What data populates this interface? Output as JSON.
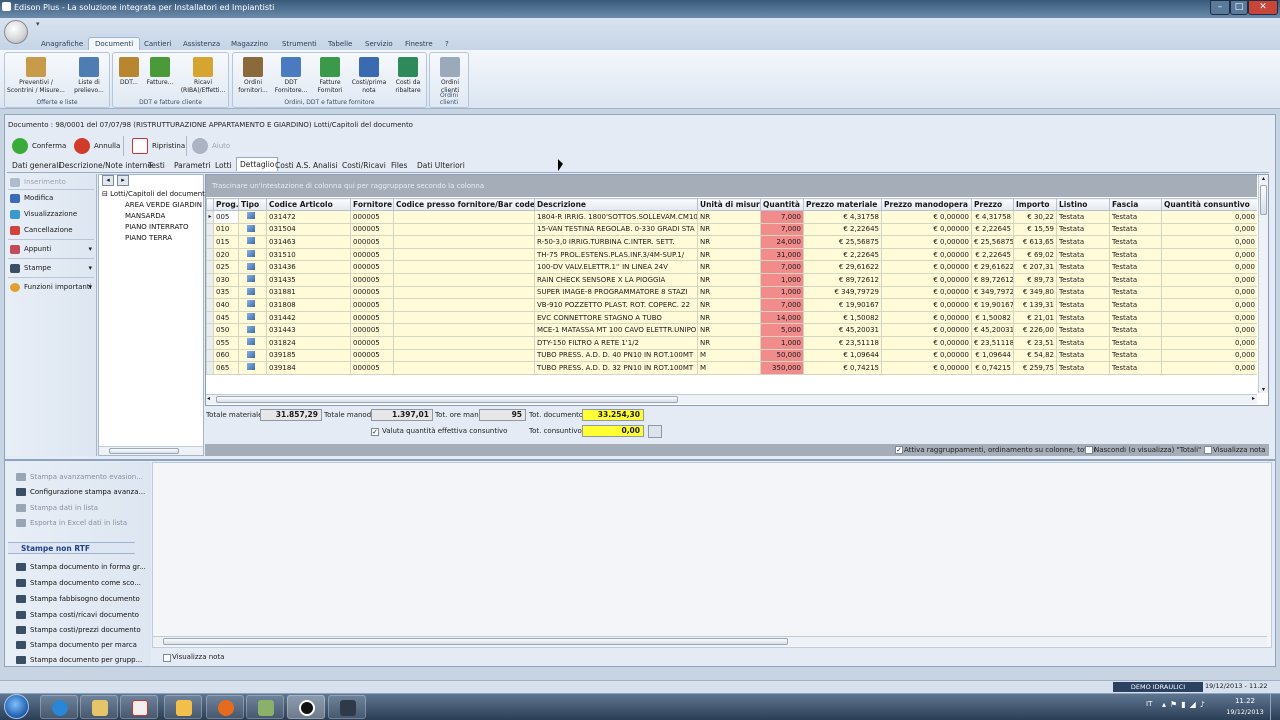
{
  "window": {
    "title": "Edison Plus - La soluzione integrata per Installatori ed Impiantisti"
  },
  "ribbon": {
    "tabs": [
      "Anagrafiche",
      "Documenti",
      "Cantieri",
      "Assistenza",
      "Magazzino",
      "Strumenti",
      "Tabelle",
      "Servizio",
      "Finestre",
      "?"
    ],
    "active_tab": "Documenti",
    "groups": [
      {
        "label": "Offerte e liste",
        "buttons": [
          "Preventivi / Scontrini / Misure...",
          "Liste di prelievo..."
        ]
      },
      {
        "label": "DDT e fatture cliente",
        "buttons": [
          "DDT...",
          "Fatture...",
          "Ricavi (RIBA)/Effetti..."
        ]
      },
      {
        "label": "Ordini, DDT e fatture fornitore",
        "buttons": [
          "Ordini fornitori...",
          "DDT Fornitore...",
          "Fatture Fornitori",
          "Costi/prima nota",
          "Costi da ribaltare"
        ]
      },
      {
        "label": "Ordini clienti",
        "buttons": [
          "Ordini clienti"
        ]
      }
    ]
  },
  "document": {
    "title": "Documento : 98/0001 del 07/07/98 (RISTRUTTURAZIONE APPARTAMENTO E GIARDINO) Lotti/Capitoli del documento"
  },
  "toolbar": {
    "confirm": "Conferma",
    "cancel": "Annulla",
    "restore": "Ripristina",
    "refresh": "Aiuto"
  },
  "subtabs": [
    "Dati generali",
    "Descrizione/Note interne",
    "Testi",
    "Parametri",
    "Lotti",
    "Dettaglio",
    "Costi A.S.",
    "Analisi",
    "Costi/Ricavi",
    "Files",
    "Dati Ulteriori"
  ],
  "active_subtab": "Dettaglio",
  "leftmenu": {
    "items": [
      "Inserimento",
      "Modifica",
      "Visualizzazione",
      "Cancellazione"
    ],
    "sections": [
      "Appunti",
      "Stampe",
      "Funzioni importanti"
    ]
  },
  "tree": {
    "root": "Lotti/Capitoli del documento",
    "children": [
      "AREA VERDE GIARDIN",
      "MANSARDA",
      "PIANO INTERRATO",
      "PIANO TERRA"
    ]
  },
  "grid": {
    "group_hint": "Trascinare un'intestazione di colonna qui per raggruppare secondo la colonna",
    "columns": [
      "Prog.",
      "Tipo",
      "Codice Articolo",
      "Fornitore",
      "Codice presso fornitore/Bar code",
      "Descrizione",
      "Unità di misura",
      "Quantità",
      "Prezzo materiale",
      "Prezzo manodopera",
      "Prezzo",
      "Importo",
      "Listino",
      "Fascia",
      "Quantità consuntivo"
    ],
    "rows": [
      [
        "005",
        "031472",
        "000005",
        "1804-R  IRRIG. 1800'SOTTOS.SOLLEVAM.CM10",
        "NR",
        "7,000",
        "€ 4,31758",
        "€ 0,00000",
        "€ 4,31758",
        "€ 30,22",
        "Testata",
        "Testata",
        "0,000"
      ],
      [
        "010",
        "031504",
        "000005",
        "15-VAN  TESTINA REGOLAB. 0-330 GRADI STA",
        "NR",
        "7,000",
        "€ 2,22645",
        "€ 0,00000",
        "€ 2,22645",
        "€ 15,59",
        "Testata",
        "Testata",
        "0,000"
      ],
      [
        "015",
        "031463",
        "000005",
        "R-50-3,0   IRRIG.TURBINA C.INTER. SETT.",
        "NR",
        "24,000",
        "€ 25,56875",
        "€ 0,00000",
        "€ 25,56875",
        "€ 613,65",
        "Testata",
        "Testata",
        "0,000"
      ],
      [
        "020",
        "031510",
        "000005",
        "TH-75  PROL.ESTENS.PLAS.INF.3/4M-SUP.1/",
        "NR",
        "31,000",
        "€ 2,22645",
        "€ 0,00000",
        "€ 2,22645",
        "€ 69,02",
        "Testata",
        "Testata",
        "0,000"
      ],
      [
        "025",
        "031436",
        "000005",
        "100-DV  VALV.ELETTR.1'' IN LINEA 24V",
        "NR",
        "7,000",
        "€ 29,61622",
        "€ 0,00000",
        "€ 29,61622",
        "€ 207,31",
        "Testata",
        "Testata",
        "0,000"
      ],
      [
        "030",
        "031435",
        "000005",
        "RAIN CHECK  SENSORE X LA PIOGGIA",
        "NR",
        "1,000",
        "€ 89,72612",
        "€ 0,00000",
        "€ 89,72612",
        "€ 89,73",
        "Testata",
        "Testata",
        "0,000"
      ],
      [
        "035",
        "031881",
        "000005",
        "SUPER IMAGE-8  PROGRAMMATORE  8 STAZI",
        "NR",
        "1,000",
        "€ 349,79729",
        "€ 0,00000",
        "€ 349,79729",
        "€ 349,80",
        "Testata",
        "Testata",
        "0,000"
      ],
      [
        "040",
        "031808",
        "000005",
        "VB-910  POZZETTO PLAST. ROT. COPERC. 22",
        "NR",
        "7,000",
        "€ 19,90167",
        "€ 0,00000",
        "€ 19,90167",
        "€ 139,31",
        "Testata",
        "Testata",
        "0,000"
      ],
      [
        "045",
        "031442",
        "000005",
        "EVC      CONNETTORE STAGNO A TUBO",
        "NR",
        "14,000",
        "€ 1,50082",
        "€ 0,00000",
        "€ 1,50082",
        "€ 21,01",
        "Testata",
        "Testata",
        "0,000"
      ],
      [
        "050",
        "031443",
        "000005",
        "MCE-1 MATASSA MT 100 CAVO ELETTR.UNIPO",
        "NR",
        "5,000",
        "€ 45,20031",
        "€ 0,00000",
        "€ 45,20031",
        "€ 226,00",
        "Testata",
        "Testata",
        "0,000"
      ],
      [
        "055",
        "031824",
        "000005",
        "DTY-150  FILTRO A RETE 1'1/2",
        "NR",
        "1,000",
        "€ 23,51118",
        "€ 0,00000",
        "€ 23,51118",
        "€ 23,51",
        "Testata",
        "Testata",
        "0,000"
      ],
      [
        "060",
        "039185",
        "000005",
        "TUBO PRESS. A.D. D. 40 PN10 IN ROT.100MT",
        "M",
        "50,000",
        "€ 1,09644",
        "€ 0,00000",
        "€ 1,09644",
        "€ 54,82",
        "Testata",
        "Testata",
        "0,000"
      ],
      [
        "065",
        "039184",
        "000005",
        "TUBO PRESS. A.D. D. 32 PN10 IN ROT.100MT",
        "M",
        "350,000",
        "€ 0,74215",
        "€ 0,00000",
        "€ 0,74215",
        "€ 259,75",
        "Testata",
        "Testata",
        "0,000"
      ]
    ]
  },
  "totals": {
    "tot_materiale_label": "Totale materiale",
    "tot_materiale": "31.857,29",
    "tot_manod_label": "Totale manod.",
    "tot_manod": "1.397,01",
    "tot_ore_label": "Tot. ore man.",
    "tot_ore": "95",
    "tot_doc_label": "Tot. documento",
    "tot_doc": "33.254,30",
    "valuta_label": "Valuta quantità effettiva consuntivo",
    "tot_cons_label": "Tot. consuntivo",
    "tot_cons": "0,00"
  },
  "gridstatus": {
    "opt1": "Attiva raggruppamenti, ordinamento su colonne, totali",
    "opt2": "Nascondi (o visualizza) \"Totali\"",
    "opt3": "Visualizza nota"
  },
  "lower": {
    "items_top": [
      "Stampa avanzamento evasion...",
      "Configurazione stampa avanza...",
      "Stampa dati in lista",
      "Esporta in Excel dati in lista"
    ],
    "header": "Stampe non RTF",
    "items_bottom": [
      "Stampa documento in forma gr...",
      "Stampa documento come sco...",
      "Stampa fabbisogno documento",
      "Stampa costi/ricavi documento",
      "Stampa costi/prezzi documento",
      "Stampa documento per marca",
      "Stampa documento per grupp..."
    ],
    "visualizza_nota": "Visualizza nota"
  },
  "appstatus": {
    "user": "DEMO IDRAULICI",
    "datetime": "19/12/2013 - 11.22"
  },
  "taskbar": {
    "lang": "IT",
    "time": "11.22",
    "date": "19/12/2013"
  },
  "colors": {
    "quantity_cell": "#f28b8b",
    "row_bg": "#fffbd8",
    "total_highlight": "#ffff33"
  }
}
